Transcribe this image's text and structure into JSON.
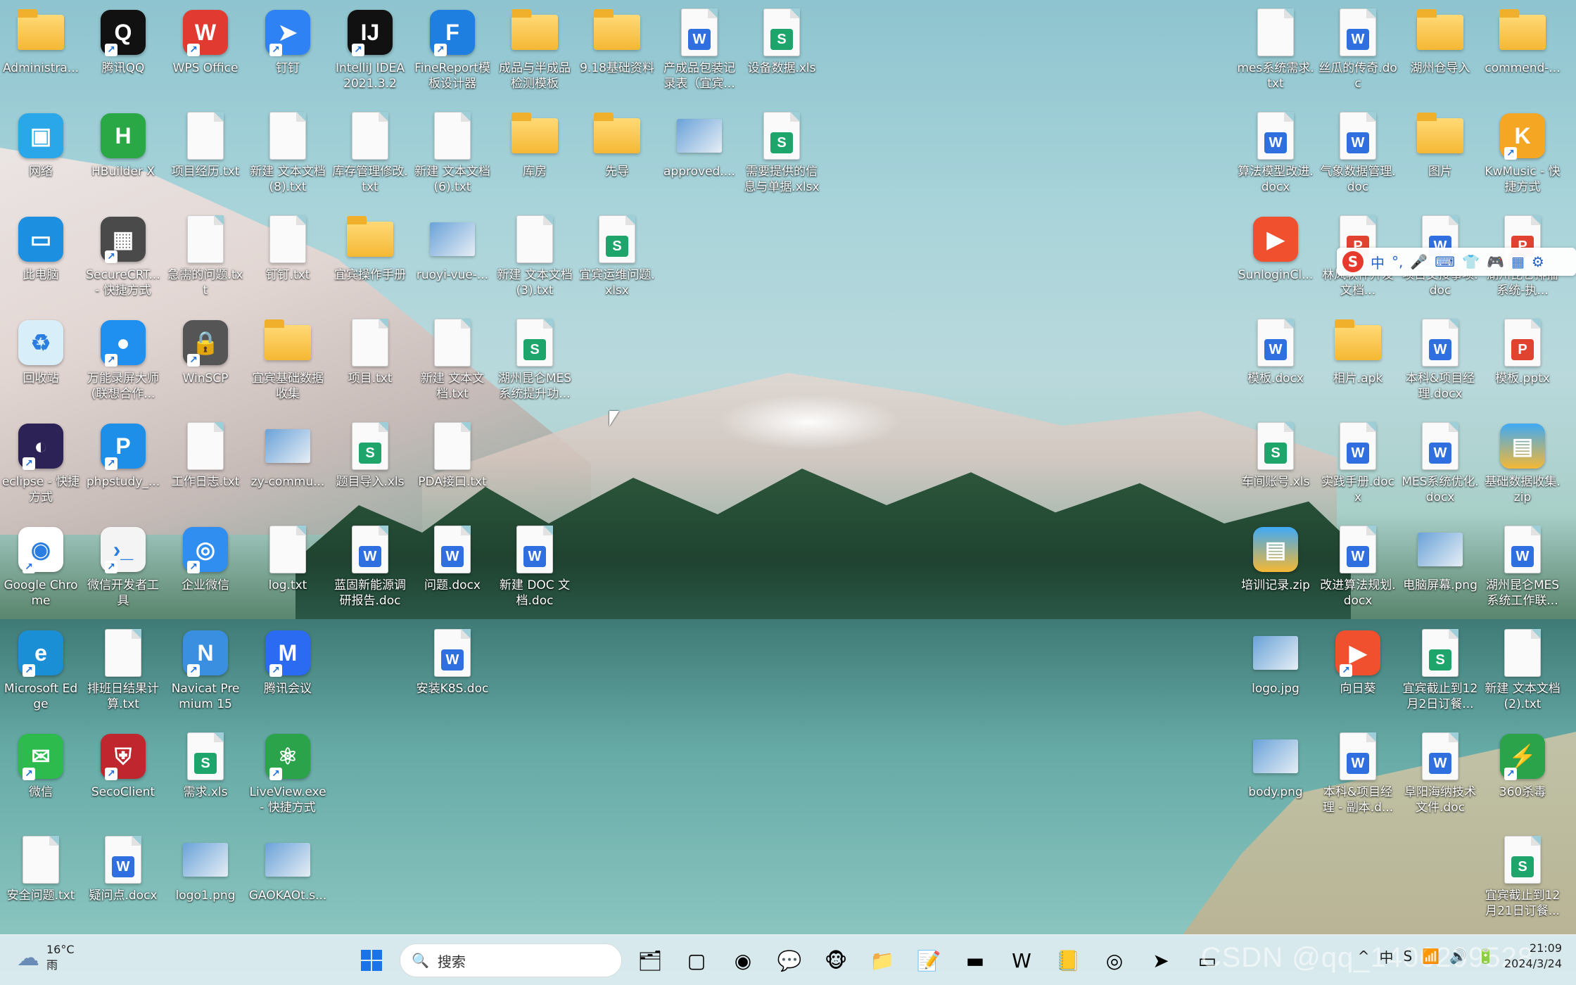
{
  "icons": [
    {
      "label": "Administra...",
      "kind": "folder",
      "name": "administrator-folder",
      "x": 0,
      "y": 0
    },
    {
      "label": "腾讯QQ",
      "kind": "app",
      "color": "#111111",
      "glyph": "Q",
      "name": "qq-app",
      "x": 1,
      "y": 0,
      "sc": true
    },
    {
      "label": "WPS Office",
      "kind": "app",
      "color": "#e13a31",
      "glyph": "W",
      "name": "wps-office-app",
      "x": 2,
      "y": 0,
      "sc": true
    },
    {
      "label": "钉钉",
      "kind": "app",
      "color": "#2f82f4",
      "glyph": "➤",
      "name": "dingtalk-app",
      "x": 3,
      "y": 0,
      "sc": true
    },
    {
      "label": "IntelliJ IDEA 2021.3.2",
      "kind": "app",
      "color": "#111111",
      "glyph": "IJ",
      "name": "intellij-idea-app",
      "x": 4,
      "y": 0,
      "sc": true
    },
    {
      "label": "FineReport模板设计器",
      "kind": "app",
      "color": "#1f7fe0",
      "glyph": "F",
      "name": "finereport-app",
      "x": 5,
      "y": 0,
      "sc": true
    },
    {
      "label": "成品与半成品检测模板",
      "kind": "folder",
      "name": "product-templates-folder",
      "x": 6,
      "y": 0
    },
    {
      "label": "9.18基础资料",
      "kind": "folder",
      "name": "basic-data-folder",
      "x": 7,
      "y": 0
    },
    {
      "label": "产成品包装记录表（宜宾...",
      "kind": "w",
      "name": "packaging-record-doc",
      "x": 8,
      "y": 0
    },
    {
      "label": "设备数据.xls",
      "kind": "s",
      "name": "equipment-data-xls",
      "x": 9,
      "y": 0
    },
    {
      "label": "网络",
      "kind": "app",
      "color": "#2aa7e8",
      "glyph": "▣",
      "name": "network-icon",
      "x": 0,
      "y": 1
    },
    {
      "label": "HBuilder X",
      "kind": "app",
      "color": "#2aa846",
      "glyph": "H",
      "name": "hbuilderx-app",
      "x": 1,
      "y": 1
    },
    {
      "label": "项目经历.txt",
      "kind": "txt",
      "name": "project-experience-txt",
      "x": 2,
      "y": 1
    },
    {
      "label": "新建 文本文档 (8).txt",
      "kind": "txt",
      "name": "new-text-8-txt",
      "x": 3,
      "y": 1
    },
    {
      "label": "库存管理修改.txt",
      "kind": "txt",
      "name": "inventory-txt",
      "x": 4,
      "y": 1
    },
    {
      "label": "新建 文本文档 (6).txt",
      "kind": "txt",
      "name": "new-text-6-txt",
      "x": 5,
      "y": 1
    },
    {
      "label": "库房",
      "kind": "folder",
      "name": "warehouse-folder",
      "x": 6,
      "y": 1
    },
    {
      "label": "先导",
      "kind": "folder",
      "name": "xiandao-folder",
      "x": 7,
      "y": 1
    },
    {
      "label": "approved....",
      "kind": "img",
      "name": "approved-image",
      "x": 8,
      "y": 1
    },
    {
      "label": "需要提供的信息与单据.xlsx",
      "kind": "s",
      "name": "required-info-xlsx",
      "x": 9,
      "y": 1
    },
    {
      "label": "此电脑",
      "kind": "app",
      "color": "#1d8fe0",
      "glyph": "▭",
      "name": "this-pc-icon",
      "x": 0,
      "y": 2
    },
    {
      "label": "SecureCRT... - 快捷方式",
      "kind": "app",
      "color": "#4a4a4a",
      "glyph": "▦",
      "name": "securecrt-app",
      "x": 1,
      "y": 2,
      "sc": true
    },
    {
      "label": "急需的问题.txt",
      "kind": "txt",
      "name": "urgent-issues-txt",
      "x": 2,
      "y": 2
    },
    {
      "label": "钉钉.txt",
      "kind": "txt",
      "name": "dingtalk-txt",
      "x": 3,
      "y": 2
    },
    {
      "label": "宜宾操作手册",
      "kind": "folder",
      "name": "yibin-manual-folder",
      "x": 4,
      "y": 2
    },
    {
      "label": "ruoyi-vue-...",
      "kind": "img",
      "name": "ruoyi-vue-file",
      "x": 5,
      "y": 2
    },
    {
      "label": "新建 文本文档 (3).txt",
      "kind": "txt",
      "name": "new-text-3-txt",
      "x": 6,
      "y": 2
    },
    {
      "label": "宜宾运维问题.xlsx",
      "kind": "s",
      "name": "yibin-ops-xlsx",
      "x": 7,
      "y": 2
    },
    {
      "label": "回收站",
      "kind": "app",
      "color": "#d8eef8",
      "glyph": "♻",
      "name": "recycle-bin-icon",
      "x": 0,
      "y": 3
    },
    {
      "label": "万能录屏大师(联想合作...",
      "kind": "app",
      "color": "#1f8ff0",
      "glyph": "●",
      "name": "screen-recorder-app",
      "x": 1,
      "y": 3,
      "sc": true
    },
    {
      "label": "WinSCP",
      "kind": "app",
      "color": "#555555",
      "glyph": "🔒",
      "name": "winscp-app",
      "x": 2,
      "y": 3,
      "sc": true
    },
    {
      "label": "宜宾基础数据收集",
      "kind": "folder",
      "name": "yibin-data-folder",
      "x": 3,
      "y": 3
    },
    {
      "label": "项目.txt",
      "kind": "txt",
      "name": "project-txt",
      "x": 4,
      "y": 3
    },
    {
      "label": "新建 文本文档.txt",
      "kind": "txt",
      "name": "new-text-txt",
      "x": 5,
      "y": 3
    },
    {
      "label": "湖州昆仑MES系统提升功...",
      "kind": "s",
      "name": "huzhou-mes-xls",
      "x": 6,
      "y": 3
    },
    {
      "label": "eclipse - 快捷方式",
      "kind": "app",
      "color": "#2c2255",
      "glyph": "◐",
      "name": "eclipse-app",
      "x": 0,
      "y": 4,
      "sc": true
    },
    {
      "label": "phpstudy_...",
      "kind": "app",
      "color": "#1e8fe8",
      "glyph": "P",
      "name": "phpstudy-app",
      "x": 1,
      "y": 4,
      "sc": true
    },
    {
      "label": "工作日志.txt",
      "kind": "txt",
      "name": "work-log-txt",
      "x": 2,
      "y": 4
    },
    {
      "label": "zy-commu...",
      "kind": "img",
      "name": "zy-commu-file",
      "x": 3,
      "y": 4
    },
    {
      "label": "题目导入.xls",
      "kind": "s",
      "name": "question-import-xls",
      "x": 4,
      "y": 4
    },
    {
      "label": "PDA接口.txt",
      "kind": "txt",
      "name": "pda-api-txt",
      "x": 5,
      "y": 4
    },
    {
      "label": "Google Chrome",
      "kind": "app",
      "color": "#ffffff",
      "glyph": "◉",
      "name": "chrome-app",
      "x": 0,
      "y": 5,
      "sc": true
    },
    {
      "label": "微信开发者工具",
      "kind": "app",
      "color": "#f4f4f4",
      "glyph": "›_",
      "name": "wechat-devtools-app",
      "x": 1,
      "y": 5,
      "sc": true
    },
    {
      "label": "企业微信",
      "kind": "app",
      "color": "#2f8ef0",
      "glyph": "◎",
      "name": "wecom-app",
      "x": 2,
      "y": 5,
      "sc": true
    },
    {
      "label": "log.txt",
      "kind": "txt",
      "name": "log-txt",
      "x": 3,
      "y": 5
    },
    {
      "label": "蓝固新能源调研报告.doc",
      "kind": "w",
      "name": "research-report-doc",
      "x": 4,
      "y": 5
    },
    {
      "label": "问题.docx",
      "kind": "w",
      "name": "issues-docx",
      "x": 5,
      "y": 5
    },
    {
      "label": "新建 DOC 文档.doc",
      "kind": "w",
      "name": "new-doc-doc",
      "x": 6,
      "y": 5
    },
    {
      "label": "Microsoft Edge",
      "kind": "app",
      "color": "#1b8fd6",
      "glyph": "e",
      "name": "edge-app",
      "x": 0,
      "y": 6,
      "sc": true
    },
    {
      "label": "排班日结果计算.txt",
      "kind": "txt",
      "name": "schedule-calc-txt",
      "x": 1,
      "y": 6
    },
    {
      "label": "Navicat Premium 15",
      "kind": "app",
      "color": "#3a8fe0",
      "glyph": "N",
      "name": "navicat-app",
      "x": 2,
      "y": 6,
      "sc": true
    },
    {
      "label": "腾讯会议",
      "kind": "app",
      "color": "#2a6bf2",
      "glyph": "M",
      "name": "tencent-meeting-app",
      "x": 3,
      "y": 6,
      "sc": true
    },
    {
      "label": "安装K8S.doc",
      "kind": "w",
      "name": "install-k8s-doc",
      "x": 5,
      "y": 6
    },
    {
      "label": "微信",
      "kind": "app",
      "color": "#2dbb4e",
      "glyph": "✉",
      "name": "wechat-app",
      "x": 0,
      "y": 7,
      "sc": true
    },
    {
      "label": "SecoClient",
      "kind": "app",
      "color": "#c0262d",
      "glyph": "⛨",
      "name": "secoclient-app",
      "x": 1,
      "y": 7,
      "sc": true
    },
    {
      "label": "需求.xls",
      "kind": "s",
      "name": "requirements-xls",
      "x": 2,
      "y": 7
    },
    {
      "label": "LiveView.exe - 快捷方式",
      "kind": "app",
      "color": "#2aa34a",
      "glyph": "⚛",
      "name": "liveview-app",
      "x": 3,
      "y": 7,
      "sc": true
    },
    {
      "label": "安全问题.txt",
      "kind": "txt",
      "name": "security-issues-txt",
      "x": 0,
      "y": 8
    },
    {
      "label": "疑问点.docx",
      "kind": "w",
      "name": "questions-docx",
      "x": 1,
      "y": 8
    },
    {
      "label": "logo1.png",
      "kind": "img",
      "name": "logo1-png",
      "x": 2,
      "y": 8
    },
    {
      "label": "GAOKAOt.s...",
      "kind": "img",
      "name": "gaokao-file",
      "x": 3,
      "y": 8
    },
    {
      "label": "mes系统需求.txt",
      "kind": "txt",
      "name": "mes-requirements-txt",
      "x": 0,
      "y": 0,
      "right": true
    },
    {
      "label": "丝瓜的传奇.doc",
      "kind": "w",
      "name": "sigua-doc",
      "x": 1,
      "y": 0,
      "right": true
    },
    {
      "label": "湖州仓导入",
      "kind": "folder",
      "name": "huzhou-import-folder",
      "x": 2,
      "y": 0,
      "right": true
    },
    {
      "label": "commend-...",
      "kind": "folder",
      "name": "commend-folder",
      "x": 3,
      "y": 0,
      "right": true
    },
    {
      "label": "算法模型改进.docx",
      "kind": "w",
      "name": "algorithm-docx",
      "x": 0,
      "y": 1,
      "right": true
    },
    {
      "label": "气象数据管理.doc",
      "kind": "w",
      "name": "weather-data-doc",
      "x": 1,
      "y": 1,
      "right": true
    },
    {
      "label": "图片",
      "kind": "folder",
      "name": "pictures-folder",
      "x": 2,
      "y": 1,
      "right": true
    },
    {
      "label": "KwMusic - 快捷方式",
      "kind": "app",
      "color": "#f5a623",
      "glyph": "K",
      "name": "kwmusic-app",
      "x": 3,
      "y": 1,
      "right": true,
      "sc": true
    },
    {
      "label": "SunloginCl...",
      "kind": "app",
      "color": "#f0502e",
      "glyph": "▶",
      "name": "sunlogin-app",
      "x": 0,
      "y": 2,
      "right": true
    },
    {
      "label": "林风软件开发文档...",
      "kind": "p",
      "name": "dev-doc-ppt",
      "x": 1,
      "y": 2,
      "right": true
    },
    {
      "label": "项目交接事项.doc",
      "kind": "w",
      "name": "handover-doc",
      "x": 2,
      "y": 2,
      "right": true
    },
    {
      "label": "湖州昆仑排播系统-执...",
      "kind": "p",
      "name": "huzhou-ppt",
      "x": 3,
      "y": 2,
      "right": true
    },
    {
      "label": "模板.docx",
      "kind": "w",
      "name": "template-docx",
      "x": 0,
      "y": 3,
      "right": true
    },
    {
      "label": "相片.apk",
      "kind": "folder",
      "name": "photo-apk-folder",
      "x": 1,
      "y": 3,
      "right": true
    },
    {
      "label": "本科&项目经理.docx",
      "kind": "w",
      "name": "resume-docx",
      "x": 2,
      "y": 3,
      "right": true
    },
    {
      "label": "模板.pptx",
      "kind": "p",
      "name": "template-pptx",
      "x": 3,
      "y": 3,
      "right": true
    },
    {
      "label": "车间账号.xls",
      "kind": "s",
      "name": "workshop-accounts-xls",
      "x": 0,
      "y": 4,
      "right": true
    },
    {
      "label": "实践手册.docx",
      "kind": "w",
      "name": "practice-manual-docx",
      "x": 1,
      "y": 4,
      "right": true
    },
    {
      "label": "MES系统优化.docx",
      "kind": "w",
      "name": "mes-optimize-docx",
      "x": 2,
      "y": 4,
      "right": true
    },
    {
      "label": "基础数据收集.zip",
      "kind": "zip",
      "name": "data-collection-zip",
      "x": 3,
      "y": 4,
      "right": true
    },
    {
      "label": "培训记录.zip",
      "kind": "zip",
      "name": "training-zip",
      "x": 0,
      "y": 5,
      "right": true
    },
    {
      "label": "改进算法规划.docx",
      "kind": "w",
      "name": "algorithm-plan-docx",
      "x": 1,
      "y": 5,
      "right": true
    },
    {
      "label": "电脑屏幕.png",
      "kind": "img",
      "name": "screen-png",
      "x": 2,
      "y": 5,
      "right": true
    },
    {
      "label": "湖州昆仑MES系统工作联...",
      "kind": "w",
      "name": "huzhou-mes-doc",
      "x": 3,
      "y": 5,
      "right": true
    },
    {
      "label": "logo.jpg",
      "kind": "img",
      "name": "logo-jpg",
      "x": 0,
      "y": 6,
      "right": true
    },
    {
      "label": "向日葵",
      "kind": "app",
      "color": "#f0502e",
      "glyph": "▶",
      "name": "sunflower-app",
      "x": 1,
      "y": 6,
      "right": true,
      "sc": true
    },
    {
      "label": "宜宾截止到12月2日订餐...",
      "kind": "s",
      "name": "yibin-orders-xls",
      "x": 2,
      "y": 6,
      "right": true
    },
    {
      "label": "新建 文本文档 (2).txt",
      "kind": "txt",
      "name": "new-text-2-txt",
      "x": 3,
      "y": 6,
      "right": true
    },
    {
      "label": "body.png",
      "kind": "img",
      "name": "body-png",
      "x": 0,
      "y": 7,
      "right": true
    },
    {
      "label": "本科&项目经理 - 副本.d...",
      "kind": "w",
      "name": "resume-copy-docx",
      "x": 1,
      "y": 7,
      "right": true
    },
    {
      "label": "阜阳海纳技术文件.doc",
      "kind": "w",
      "name": "fuyang-doc",
      "x": 2,
      "y": 7,
      "right": true
    },
    {
      "label": "360杀毒",
      "kind": "app",
      "color": "#2aa34a",
      "glyph": "⚡",
      "name": "360-antivirus-app",
      "x": 3,
      "y": 7,
      "right": true,
      "sc": true
    },
    {
      "label": "宜宾截止到12月21日订餐...",
      "kind": "s",
      "name": "yibin-orders-21-xls",
      "x": 3,
      "y": 8,
      "right": true
    }
  ],
  "ime": {
    "logo": "S",
    "items": [
      "中",
      "°,",
      "🎤",
      "⌨",
      "👕",
      "🎮",
      "▦",
      "⚙"
    ]
  },
  "taskbar": {
    "weather_temp": "16°C",
    "weather_desc": "雨",
    "search_placeholder": "搜索",
    "apps": [
      "🗂",
      "▢",
      "◉",
      "💬",
      "🐵",
      "📁",
      "📝",
      "▬",
      "W",
      "📒",
      "◎",
      "➤",
      "▭"
    ],
    "time": "21:09",
    "date": "2024/3/24",
    "tray": [
      "^",
      "中",
      "S",
      "📶",
      "🔊",
      "🔋"
    ],
    "watermark": "CSDN @qq_1406299528"
  }
}
